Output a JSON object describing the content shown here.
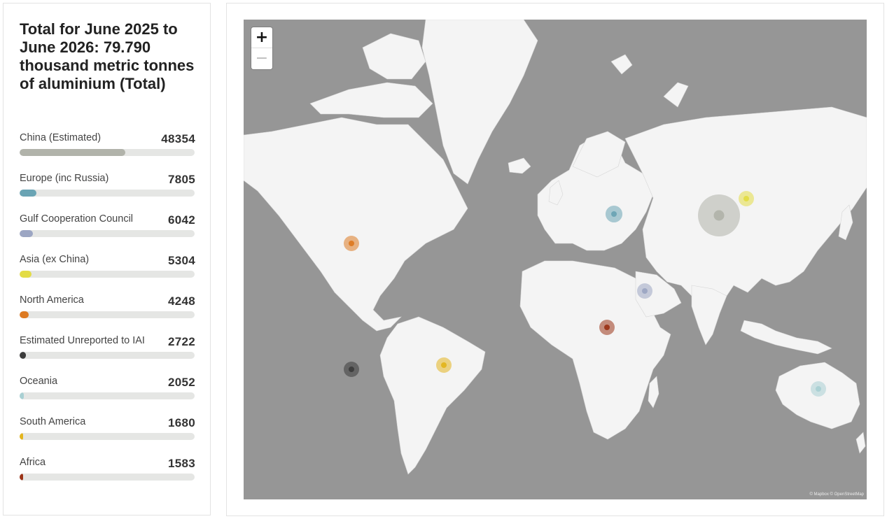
{
  "summary": {
    "title": "Total for June 2025 to June 2026: 79.790 thousand metric tonnes of aluminium (Total)"
  },
  "regions": [
    {
      "label": "China (Estimated)",
      "value": 48354,
      "display": "48354",
      "color": "#b1b3aa"
    },
    {
      "label": "Europe (inc Russia)",
      "value": 7805,
      "display": "7805",
      "color": "#6aa4b4"
    },
    {
      "label": "Gulf Cooperation Council",
      "value": 6042,
      "display": "6042",
      "color": "#9ca6c3"
    },
    {
      "label": "Asia (ex China)",
      "value": 5304,
      "display": "5304",
      "color": "#e3dc45"
    },
    {
      "label": "North America",
      "value": 4248,
      "display": "4248",
      "color": "#dd7a22"
    },
    {
      "label": "Estimated Unreported to IAI",
      "value": 2722,
      "display": "2722",
      "color": "#3c3c3c"
    },
    {
      "label": "Oceania",
      "value": 2052,
      "display": "2052",
      "color": "#a9d0d3"
    },
    {
      "label": "South America",
      "value": 1680,
      "display": "1680",
      "color": "#e3b51f"
    },
    {
      "label": "Africa",
      "value": 1583,
      "display": "1583",
      "color": "#9b3418"
    }
  ],
  "bar_scale_max": 80000,
  "map": {
    "zoom_in_label": "+",
    "zoom_out_label": "−",
    "attribution": "© Mapbox © OpenStreetMap",
    "ocean_color": "#969696",
    "land_color": "#f4f4f4"
  }
}
